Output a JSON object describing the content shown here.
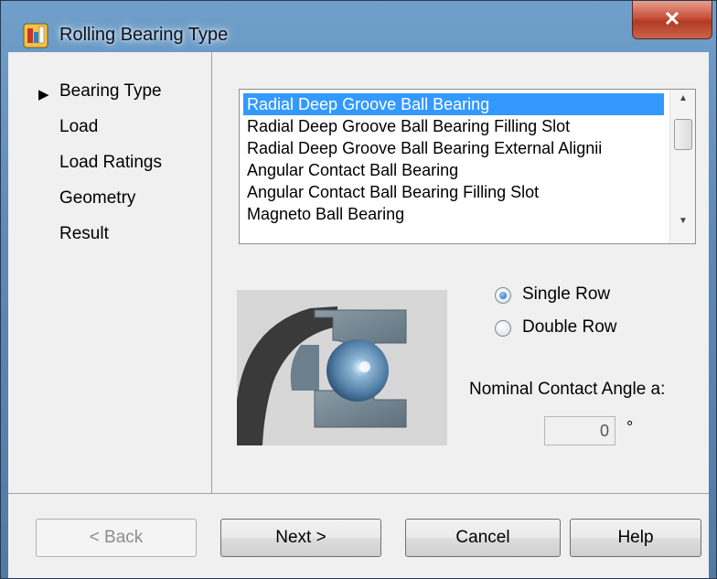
{
  "window": {
    "title": "Rolling Bearing Type",
    "close_glyph": "✕",
    "accent": "#3399ff"
  },
  "nav": {
    "current_marker": "▶",
    "items": [
      {
        "label": "Bearing Type",
        "current": true
      },
      {
        "label": "Load",
        "current": false
      },
      {
        "label": "Load Ratings",
        "current": false
      },
      {
        "label": "Geometry",
        "current": false
      },
      {
        "label": "Result",
        "current": false
      }
    ]
  },
  "bearing_list": {
    "selected_index": 0,
    "items": [
      "Radial Deep Groove Ball Bearing",
      "Radial Deep Groove Ball Bearing Filling Slot",
      "Radial Deep Groove Ball Bearing External Alignii",
      "Angular Contact Ball Bearing",
      "Angular Contact Ball Bearing Filling Slot",
      "Magneto Ball Bearing"
    ],
    "scroll_up_glyph": "▲",
    "scroll_down_glyph": "▼"
  },
  "rows": {
    "options": [
      {
        "label": "Single Row",
        "checked": true
      },
      {
        "label": "Double Row",
        "checked": false
      }
    ]
  },
  "contact_angle": {
    "label": "Nominal Contact Angle a:",
    "value": "0",
    "unit": "°"
  },
  "buttons": {
    "back": "< Back",
    "next": "Next >",
    "cancel": "Cancel",
    "help": "Help"
  }
}
